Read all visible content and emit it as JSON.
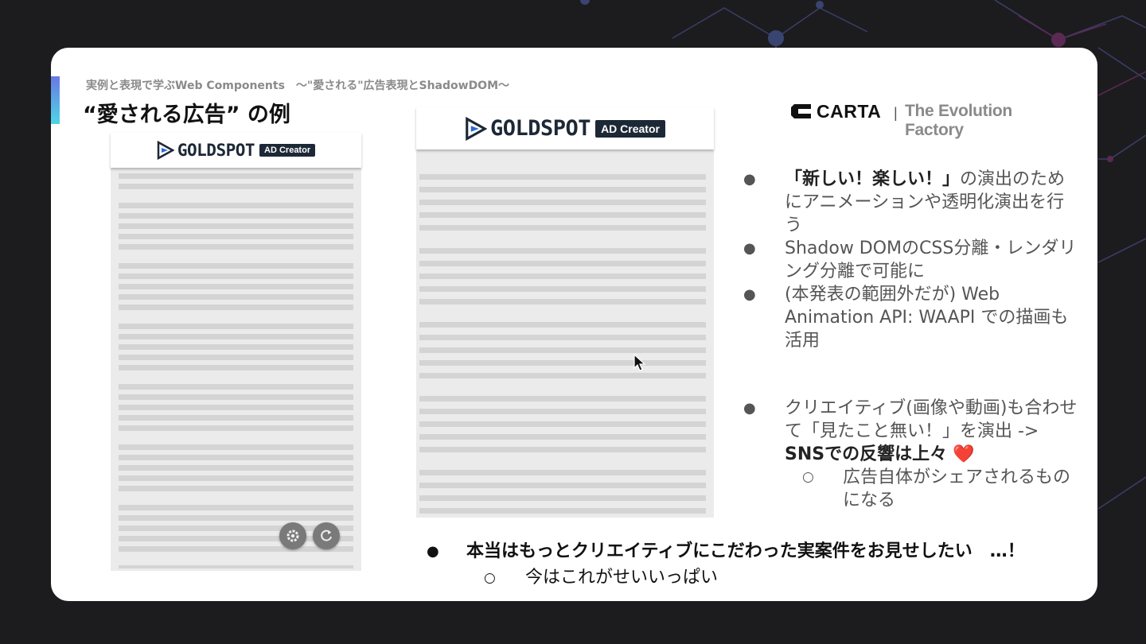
{
  "slide": {
    "subtitle": "実例と表現で学ぶWeb Components　～\"愛される\"広告表現とShadowDOM～",
    "title": "“愛される広告” の例"
  },
  "brand": {
    "name": "CARTA",
    "separator": "|",
    "tagline": "The Evolution Factory"
  },
  "ad_logo": {
    "word": "GOLDSPOT",
    "badge": "AD Creator"
  },
  "controls": {
    "settings_icon": "gear-icon",
    "refresh_icon": "refresh-icon"
  },
  "bullets": [
    {
      "bold": "「新しい！楽しい！」",
      "text": "の演出のためにアニメーションや透明化演出を行う"
    },
    {
      "bold": "",
      "text": "Shadow DOMのCSS分離・レンダリング分離で可能に"
    },
    {
      "bold": "",
      "text": "(本発表の範囲外だが) Web Animation API: WAAPI での描画も活用"
    }
  ],
  "bullets2": {
    "text": "クリエイティブ(画像や動画)も合わせて「見たこと無い！」を演出 ->",
    "bold": "SNSでの反響は上々",
    "heart": "❤️",
    "sub": "広告自体がシェアされるものになる"
  },
  "bottom": {
    "main": "本当はもっとクリエイティブにこだわった実案件をお見せしたい　…！",
    "sub": "今はこれがせいいっぱい"
  },
  "colors": {
    "accent_top": "#6a78e6",
    "accent_bottom": "#4fd6e6",
    "logo_navy": "#1d2836",
    "heart": "#e02424"
  }
}
